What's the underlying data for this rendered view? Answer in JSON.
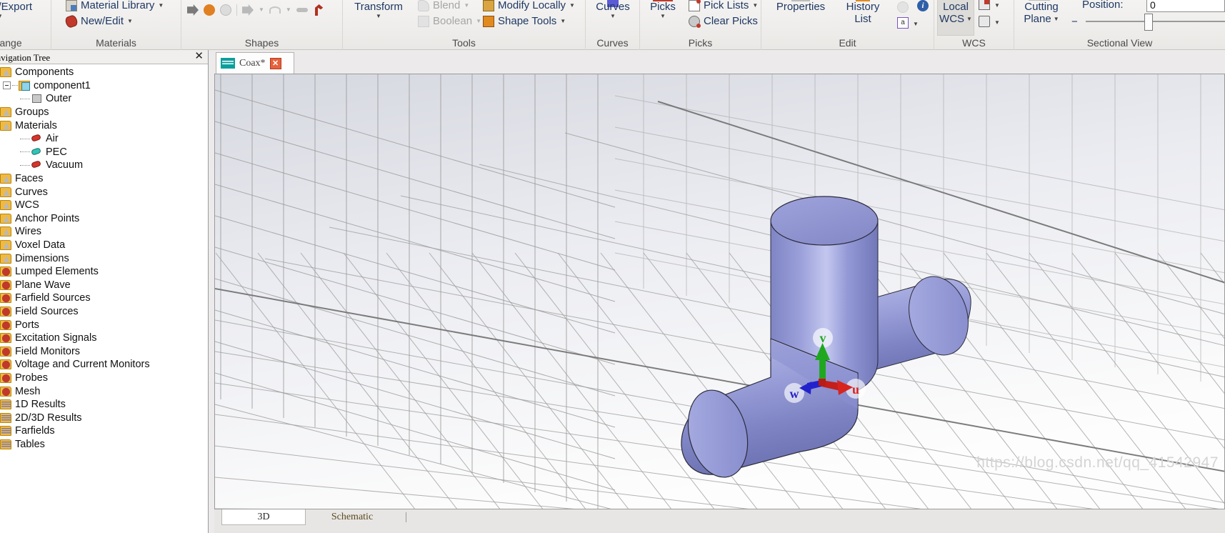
{
  "ribbon": {
    "groups": [
      {
        "title": "Exchange",
        "items": [
          {
            "label": "Import/Export",
            "icon": "import-export-icon"
          }
        ]
      },
      {
        "title": "Materials",
        "items": [
          {
            "label": "Material Library",
            "icon": "material-library-icon"
          },
          {
            "label": "New/Edit",
            "icon": "new-edit-material-icon"
          }
        ]
      },
      {
        "title": "Shapes",
        "items": [
          {
            "label": "",
            "icon": "extrude-icon"
          },
          {
            "label": "",
            "icon": "rotate-icon"
          },
          {
            "label": "",
            "icon": "loft-icon"
          },
          {
            "label": "",
            "icon": "extrude-curve-icon"
          },
          {
            "label": "",
            "icon": "trace-from-curve-icon"
          },
          {
            "label": "",
            "icon": "bend-sheet-icon"
          },
          {
            "label": "",
            "icon": "cylinder-icon"
          }
        ]
      },
      {
        "title": "Tools",
        "items": [
          {
            "label": "Transform",
            "icon": "transform-icon"
          },
          {
            "label": "Blend",
            "icon": "blend-icon",
            "disabled": true
          },
          {
            "label": "Boolean",
            "icon": "boolean-icon",
            "disabled": true
          },
          {
            "label": "Modify Locally",
            "icon": "modify-locally-icon"
          },
          {
            "label": "Shape Tools",
            "icon": "shape-tools-icon"
          }
        ]
      },
      {
        "title": "Curves",
        "items": [
          {
            "label": "Curves",
            "icon": "curves-icon"
          }
        ]
      },
      {
        "title": "Picks",
        "items": [
          {
            "label": "Picks",
            "icon": "picks-icon"
          },
          {
            "label": "Pick Lists",
            "icon": "pick-lists-icon"
          },
          {
            "label": "Clear Picks",
            "icon": "clear-picks-icon"
          }
        ]
      },
      {
        "title": "Edit",
        "items": [
          {
            "label": "Properties",
            "icon": "properties-icon",
            "disabled": true
          },
          {
            "label": "History List",
            "icon": "history-list-icon"
          },
          {
            "label": "",
            "icon": "update-icon",
            "disabled": true
          },
          {
            "label": "",
            "icon": "info-icon"
          },
          {
            "label": "",
            "icon": "parameters-icon"
          }
        ]
      },
      {
        "title": "WCS",
        "items": [
          {
            "label": "Local WCS",
            "icon": "local-wcs-icon"
          },
          {
            "label": "",
            "icon": "wcs-transform-icon"
          },
          {
            "label": "",
            "icon": "wcs-align-icon"
          }
        ]
      },
      {
        "title": "Sectional View",
        "items": [
          {
            "label": "Cutting Plane",
            "icon": "cutting-plane-icon"
          },
          {
            "label": "Position:",
            "icon": "position-label"
          }
        ]
      }
    ],
    "position_label": "Position:",
    "position_value": "0",
    "minus_label": "−"
  },
  "navigation": {
    "title": "Navigation Tree",
    "close_label": "✕",
    "items": [
      {
        "label": "Components",
        "icon": "folder-geometry-icon",
        "indent": 0,
        "type": "geo"
      },
      {
        "label": "component1",
        "icon": "component-icon",
        "indent": 1,
        "type": "comp",
        "expander": true
      },
      {
        "label": "Outer",
        "icon": "solid-cube-icon",
        "indent": 2,
        "type": "solid"
      },
      {
        "label": "Groups",
        "icon": "folder-geometry-icon",
        "indent": 0,
        "type": "geo"
      },
      {
        "label": "Materials",
        "icon": "folder-geometry-icon",
        "indent": 0,
        "type": "geo"
      },
      {
        "label": "Air",
        "icon": "material-icon",
        "indent": 2,
        "type": "mat",
        "color": "#d6342c"
      },
      {
        "label": "PEC",
        "icon": "material-icon",
        "indent": 2,
        "type": "mat",
        "color": "#2ec4b6"
      },
      {
        "label": "Vacuum",
        "icon": "material-icon",
        "indent": 2,
        "type": "mat",
        "color": "#d6342c"
      },
      {
        "label": "Faces",
        "icon": "folder-geometry-icon",
        "indent": 0,
        "type": "geo"
      },
      {
        "label": "Curves",
        "icon": "folder-geometry-icon",
        "indent": 0,
        "type": "geo"
      },
      {
        "label": "WCS",
        "icon": "folder-geometry-icon",
        "indent": 0,
        "type": "geo"
      },
      {
        "label": "Anchor Points",
        "icon": "folder-geometry-icon",
        "indent": 0,
        "type": "geo"
      },
      {
        "label": "Wires",
        "icon": "folder-geometry-icon",
        "indent": 0,
        "type": "geo"
      },
      {
        "label": "Voxel Data",
        "icon": "folder-geometry-icon",
        "indent": 0,
        "type": "geo"
      },
      {
        "label": "Dimensions",
        "icon": "folder-geometry-icon",
        "indent": 0,
        "type": "geo"
      },
      {
        "label": "Lumped Elements",
        "icon": "folder-source-icon",
        "indent": 0,
        "type": "gear"
      },
      {
        "label": "Plane Wave",
        "icon": "folder-source-icon",
        "indent": 0,
        "type": "gear"
      },
      {
        "label": "Farfield Sources",
        "icon": "folder-source-icon",
        "indent": 0,
        "type": "gear"
      },
      {
        "label": "Field Sources",
        "icon": "folder-source-icon",
        "indent": 0,
        "type": "gear"
      },
      {
        "label": "Ports",
        "icon": "folder-source-icon",
        "indent": 0,
        "type": "gear"
      },
      {
        "label": "Excitation Signals",
        "icon": "folder-source-icon",
        "indent": 0,
        "type": "gear"
      },
      {
        "label": "Field Monitors",
        "icon": "folder-source-icon",
        "indent": 0,
        "type": "gear"
      },
      {
        "label": "Voltage and Current Monitors",
        "icon": "folder-source-icon",
        "indent": 0,
        "type": "gear"
      },
      {
        "label": "Probes",
        "icon": "folder-source-icon",
        "indent": 0,
        "type": "gear"
      },
      {
        "label": "Mesh",
        "icon": "folder-source-icon",
        "indent": 0,
        "type": "gear"
      },
      {
        "label": "1D Results",
        "icon": "folder-results-icon",
        "indent": 0,
        "type": "res"
      },
      {
        "label": "2D/3D Results",
        "icon": "folder-results-icon",
        "indent": 0,
        "type": "res"
      },
      {
        "label": "Farfields",
        "icon": "folder-results-icon",
        "indent": 0,
        "type": "res"
      },
      {
        "label": "Tables",
        "icon": "folder-results-icon",
        "indent": 0,
        "type": "res"
      }
    ]
  },
  "document": {
    "tab_label": "Coax*",
    "tab_close": "✕"
  },
  "viewport": {
    "axis_u": "u",
    "axis_v": "v",
    "axis_w": "w",
    "colors": {
      "axis_u": "#d8241f",
      "axis_v": "#1fa81f",
      "axis_w": "#2222cc",
      "solid_fill": "#8e93cc",
      "grid_line": "#9a9a9a",
      "background": "#fbfbfc"
    }
  },
  "bottom_tabs": {
    "tabs": [
      {
        "label": "3D",
        "active": true
      },
      {
        "label": "Schematic",
        "active": false
      }
    ]
  },
  "watermark": {
    "text": "https://blog.csdn.net/qq_41542947"
  }
}
